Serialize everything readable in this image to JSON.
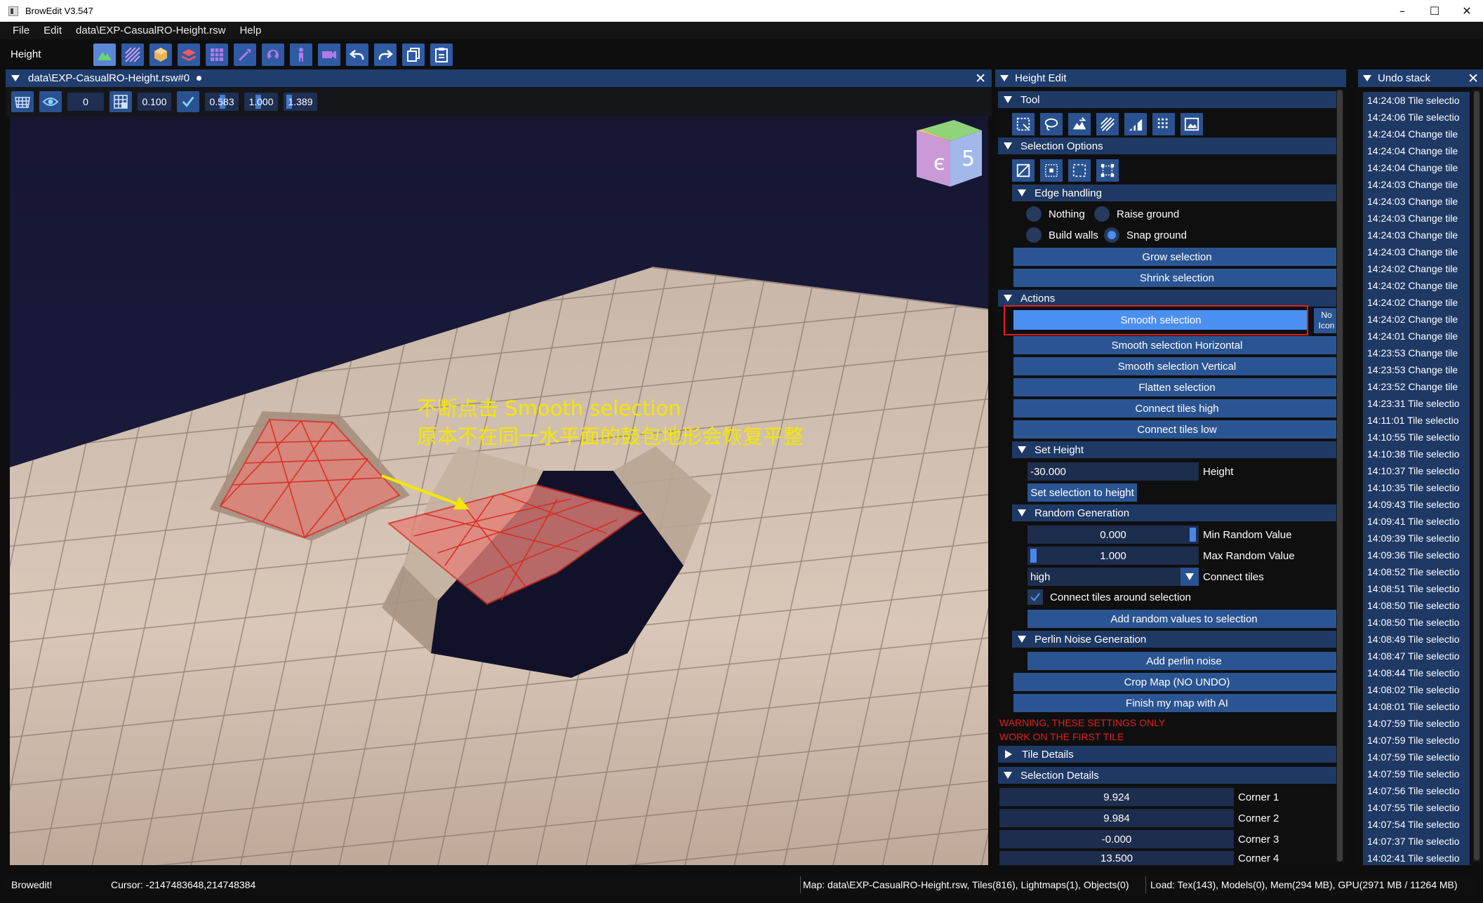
{
  "window": {
    "title": "BrowEdit V3.547",
    "controls": [
      "–",
      "☐",
      "✕"
    ]
  },
  "menu": [
    "File",
    "Edit",
    "data\\EXP-CasualRO-Height.rsw",
    "Help"
  ],
  "toolbar": {
    "mode_label": "Height",
    "buttons": [
      "height-mode-icon",
      "texture-mode-icon",
      "object-mode-icon",
      "wall-mode-icon",
      "gat-mode-icon",
      "wand-mode-icon",
      "sprite-mode-icon",
      "person-mode-icon",
      "camera-mode-icon",
      "undo-icon",
      "redo-icon",
      "copy-icon",
      "paste-icon"
    ],
    "accent": "#2f5aa4"
  },
  "viewport": {
    "tab_label": "data\\EXP-CasualRO-Height.rsw#0",
    "close": "✕",
    "fields": {
      "rotation": "0",
      "grid_size": "0.100",
      "grid_offset": "0.583",
      "scale": "1.000",
      "third": "1.389"
    },
    "annotation": {
      "line1": "不断点击 Smooth selection",
      "line2": "原本不在同一水平面的鼓包地形会恢复平整",
      "color": "#f3e800"
    }
  },
  "height_edit": {
    "title": "Height Edit",
    "tool_header": "Tool",
    "tool_icons": [
      "rect-select-icon",
      "lasso-select-icon",
      "raise-terrain-icon",
      "hatch-select-icon",
      "slope-icon",
      "dots-select-icon",
      "image-select-icon"
    ],
    "selection_options_header": "Selection Options",
    "selection_icons": [
      "deselect-icon",
      "select-inner-icon",
      "select-border-icon",
      "select-corners-icon"
    ],
    "edge_handling_header": "Edge handling",
    "edge_options": [
      {
        "label": "Nothing",
        "checked": false
      },
      {
        "label": "Raise ground",
        "checked": false
      },
      {
        "label": "Build walls",
        "checked": false
      },
      {
        "label": "Snap ground",
        "checked": true
      }
    ],
    "grow_selection": "Grow selection",
    "shrink_selection": "Shrink selection",
    "actions_header": "Actions",
    "smooth_selection": "Smooth selection",
    "no_icon": "No Icon",
    "smooth_horizontal": "Smooth selection Horizontal",
    "smooth_vertical": "Smooth selection Vertical",
    "flatten": "Flatten selection",
    "connect_high": "Connect tiles high",
    "connect_low": "Connect tiles low",
    "set_height_header": "Set Height",
    "height_value": "-30.000",
    "height_label": "Height",
    "set_selection_to_height": "Set selection to height",
    "random_header": "Random Generation",
    "min_random_value": "0.000",
    "min_random_label": "Min Random Value",
    "max_random_value": "1.000",
    "max_random_label": "Max Random Value",
    "connect_mode": "high",
    "connect_tiles_label": "Connect tiles",
    "connect_around_label": "Connect tiles around selection",
    "connect_around_checked": true,
    "add_random": "Add random values to selection",
    "perlin_header": "Perlin Noise Generation",
    "add_perlin": "Add perlin noise",
    "crop_map": "Crop Map (NO UNDO)",
    "finish_ai": "Finish my map with AI",
    "warning_line1": "WARNING, THESE SETTINGS ONLY",
    "warning_line2": "WORK ON THE FIRST TILE",
    "warning_color": "#e0201e",
    "tile_details_header": "Tile Details",
    "selection_details_header": "Selection Details",
    "corners": [
      {
        "value": "9.924",
        "label": "Corner 1"
      },
      {
        "value": "9.984",
        "label": "Corner 2"
      },
      {
        "value": "-0.000",
        "label": "Corner 3"
      },
      {
        "value": "13.500",
        "label": "Corner 4"
      }
    ]
  },
  "undo_stack": {
    "title": "Undo stack",
    "close": "✕",
    "items": [
      "14:24:08 Tile selectio",
      "14:24:06 Tile selectio",
      "14:24:04 Change tile",
      "14:24:04 Change tile",
      "14:24:04 Change tile",
      "14:24:03 Change tile",
      "14:24:03 Change tile",
      "14:24:03 Change tile",
      "14:24:03 Change tile",
      "14:24:03 Change tile",
      "14:24:02 Change tile",
      "14:24:02 Change tile",
      "14:24:02 Change tile",
      "14:24:02 Change tile",
      "14:24:01 Change tile",
      "14:23:53 Change tile",
      "14:23:53 Change tile",
      "14:23:52 Change tile",
      "14:23:31 Tile selectio",
      "14:11:01 Tile selectio",
      "14:10:55 Tile selectio",
      "14:10:38 Tile selectio",
      "14:10:37 Tile selectio",
      "14:10:35 Tile selectio",
      "14:09:43 Tile selectio",
      "14:09:41 Tile selectio",
      "14:09:39 Tile selectio",
      "14:09:36 Tile selectio",
      "14:08:52 Tile selectio",
      "14:08:51 Tile selectio",
      "14:08:50 Tile selectio",
      "14:08:50 Tile selectio",
      "14:08:49 Tile selectio",
      "14:08:47 Tile selectio",
      "14:08:44 Tile selectio",
      "14:08:02 Tile selectio",
      "14:08:01 Tile selectio",
      "14:07:59 Tile selectio",
      "14:07:59 Tile selectio",
      "14:07:59 Tile selectio",
      "14:07:59 Tile selectio",
      "14:07:56 Tile selectio",
      "14:07:55 Tile selectio",
      "14:07:54 Tile selectio",
      "14:07:37 Tile selectio",
      "14:02:41 Tile selectio"
    ]
  },
  "status": {
    "app": "Browedit!",
    "cursor": "Cursor: -2147483648,214748384",
    "map": "Map: data\\EXP-CasualRO-Height.rsw, Tiles(816), Lightmaps(1), Objects(0)",
    "load": "Load: Tex(143), Models(0), Mem(294 MB), GPU(2971 MB / 11264 MB)"
  }
}
